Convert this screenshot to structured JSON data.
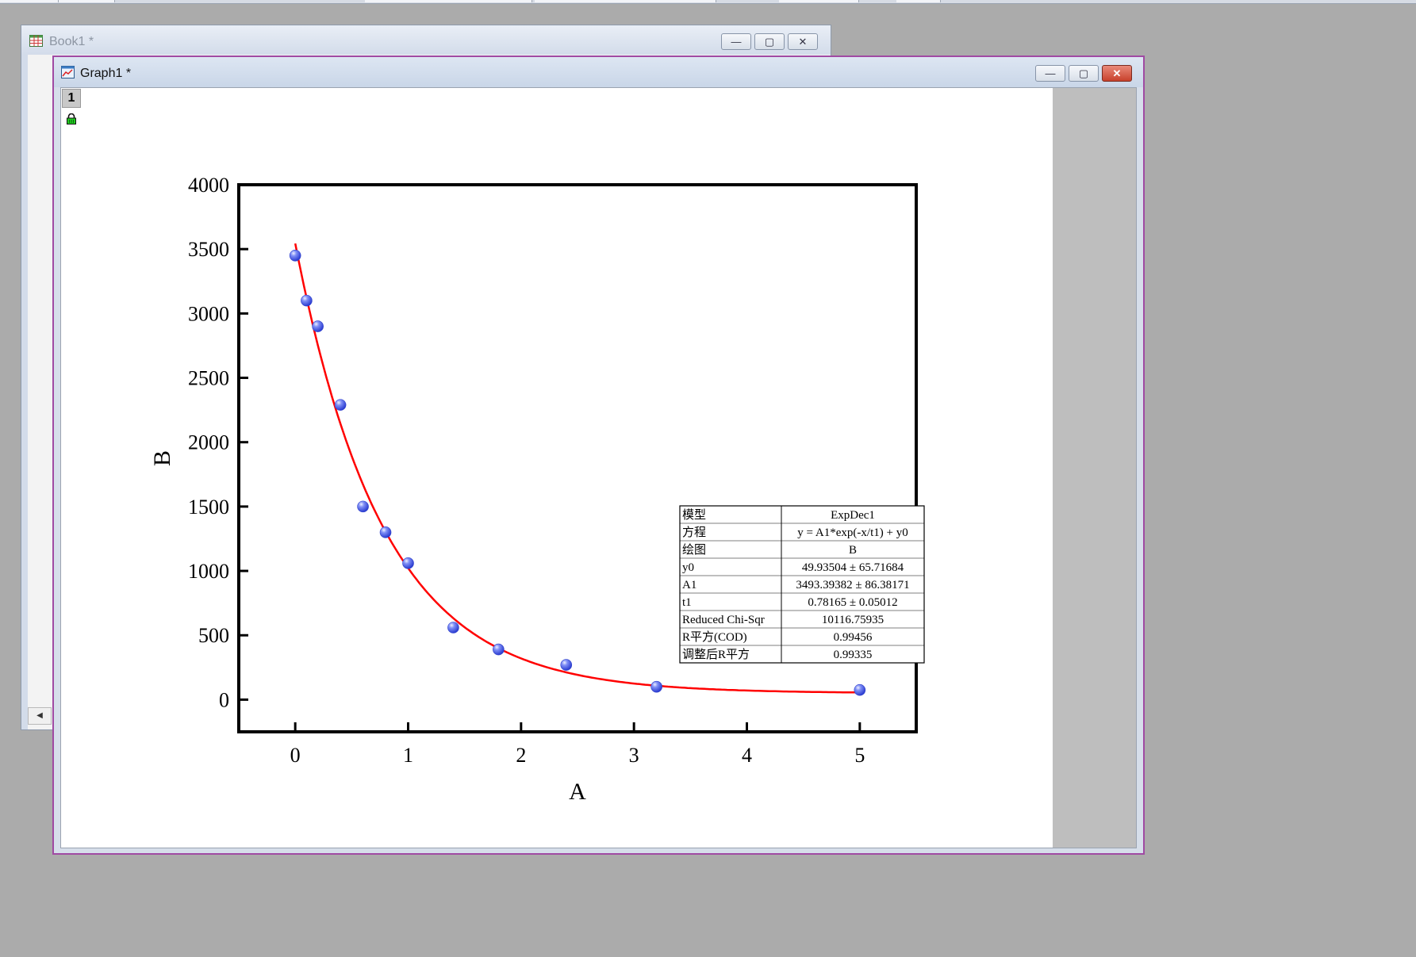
{
  "book_window": {
    "title": "Book1 *"
  },
  "graph_window": {
    "title": "Graph1 *",
    "layer_label": "1"
  },
  "window_buttons": {
    "minimize": "—",
    "maximize": "▢",
    "close": "✕"
  },
  "chart_data": {
    "type": "scatter",
    "xlabel": "A",
    "ylabel": "B",
    "xlim": [
      -0.5,
      5.5
    ],
    "ylim": [
      -250,
      4000
    ],
    "xticks": [
      0,
      1,
      2,
      3,
      4,
      5
    ],
    "yticks": [
      0,
      500,
      1000,
      1500,
      2000,
      2500,
      3000,
      3500,
      4000
    ],
    "grid": false,
    "series": [
      {
        "type": "scatter",
        "color": "#5a6ef0",
        "x": [
          0,
          0.1,
          0.2,
          0.4,
          0.6,
          0.8,
          1.0,
          1.4,
          1.8,
          2.4,
          3.2,
          5.0
        ],
        "y": [
          3450,
          3100,
          2900,
          2290,
          1500,
          1300,
          1060,
          560,
          390,
          270,
          100,
          75
        ]
      },
      {
        "type": "line",
        "color": "#ff0000",
        "model": {
          "y0": 49.93504,
          "A1": 3493.39382,
          "t1": 0.78165
        },
        "x_range": [
          0,
          5
        ]
      }
    ],
    "fit_table": {
      "rows": [
        [
          "模型",
          "ExpDec1"
        ],
        [
          "方程",
          "y = A1*exp(-x/t1) + y0"
        ],
        [
          "绘图",
          "B"
        ],
        [
          "y0",
          "49.93504 ± 65.71684"
        ],
        [
          "A1",
          "3493.39382 ± 86.38171"
        ],
        [
          "t1",
          "0.78165 ± 0.05012"
        ],
        [
          "Reduced Chi-Sqr",
          "10116.75935"
        ],
        [
          "R平方(COD)",
          "0.99456"
        ],
        [
          "调整后R平方",
          "0.99335"
        ]
      ]
    }
  }
}
